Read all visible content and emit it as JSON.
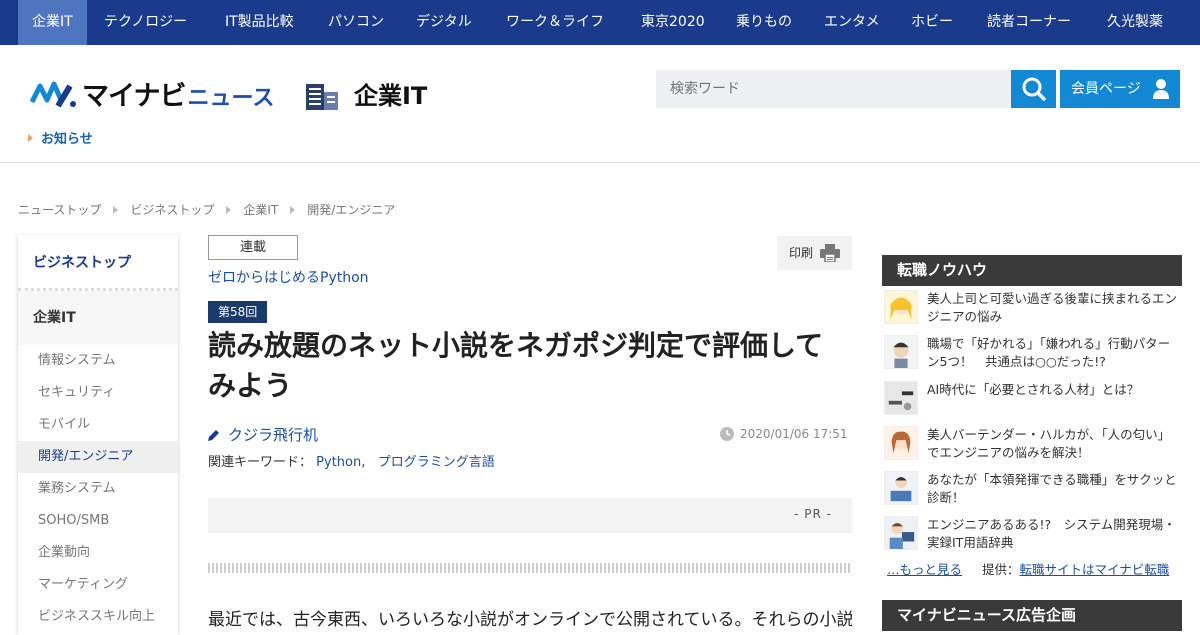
{
  "topnav": {
    "items": [
      "企業IT",
      "テクノロジー",
      "IT製品比較",
      "パソコン",
      "デジタル",
      "ワーク＆ライフ",
      "東京2020",
      "乗りもの",
      "エンタメ",
      "ホビー",
      "読者コーナー",
      "久光製薬"
    ]
  },
  "header": {
    "logo_main": "マイナビ",
    "logo_sub": "ニュース",
    "section_label": "企業IT",
    "search_placeholder": "検索ワード",
    "member_label": "会員ページ",
    "notice": "お知らせ"
  },
  "breadcrumb": [
    "ニューストップ",
    "ビジネストップ",
    "企業IT",
    "開発/エンジニア"
  ],
  "left_sidebar": {
    "top": "ビジネストップ",
    "category": "企業IT",
    "items": [
      "情報システム",
      "セキュリティ",
      "モバイル",
      "開発/エンジニア",
      "業務システム",
      "SOHO/SMB",
      "企業動向",
      "マーケティング",
      "ビジネススキル向上"
    ],
    "active_index": 3
  },
  "article": {
    "series_tag": "連載",
    "series_name": "ゼロからはじめるPython",
    "print_label": "印刷",
    "episode": "第58回",
    "title": "読み放題のネット小説をネガポジ判定で評価してみよう",
    "author": "クジラ飛行机",
    "date": "2020/01/06 17:51",
    "keywords_label": "関連キーワード：",
    "keywords": [
      "Python",
      "プログラミング言語"
    ],
    "pr": "- PR -",
    "body_start": "最近では、古今東西、いろいろな小説がオンラインで公開されている。それらの小説を"
  },
  "right_sidebar": {
    "heading": "転職ノウハウ",
    "items": [
      "美人上司と可愛い過ぎる後輩に挟まれるエンジニアの悩み",
      "職場で「好かれる」「嫌われる」行動パターン5つ！　共通点は○○だった!?",
      "AI時代に「必要とされる人材」とは？",
      "美人バーテンダー・ハルカが、「人の匂い」でエンジニアの悩みを解決！",
      "あなたが「本領発揮できる職種」をサクッと診断！",
      "エンジニアあるある!?　システム開発現場・実録IT用語辞典"
    ],
    "more": "…もっと見る",
    "credit_label": "提供：",
    "credit_link": "転職サイトはマイナビ転職",
    "ad_heading": "マイナビニュース広告企画"
  },
  "colors": {
    "nav_bg": "#1a3a8c",
    "nav_active": "#4f74c0",
    "accent_blue": "#1388d4",
    "link": "#1a4fa0"
  }
}
